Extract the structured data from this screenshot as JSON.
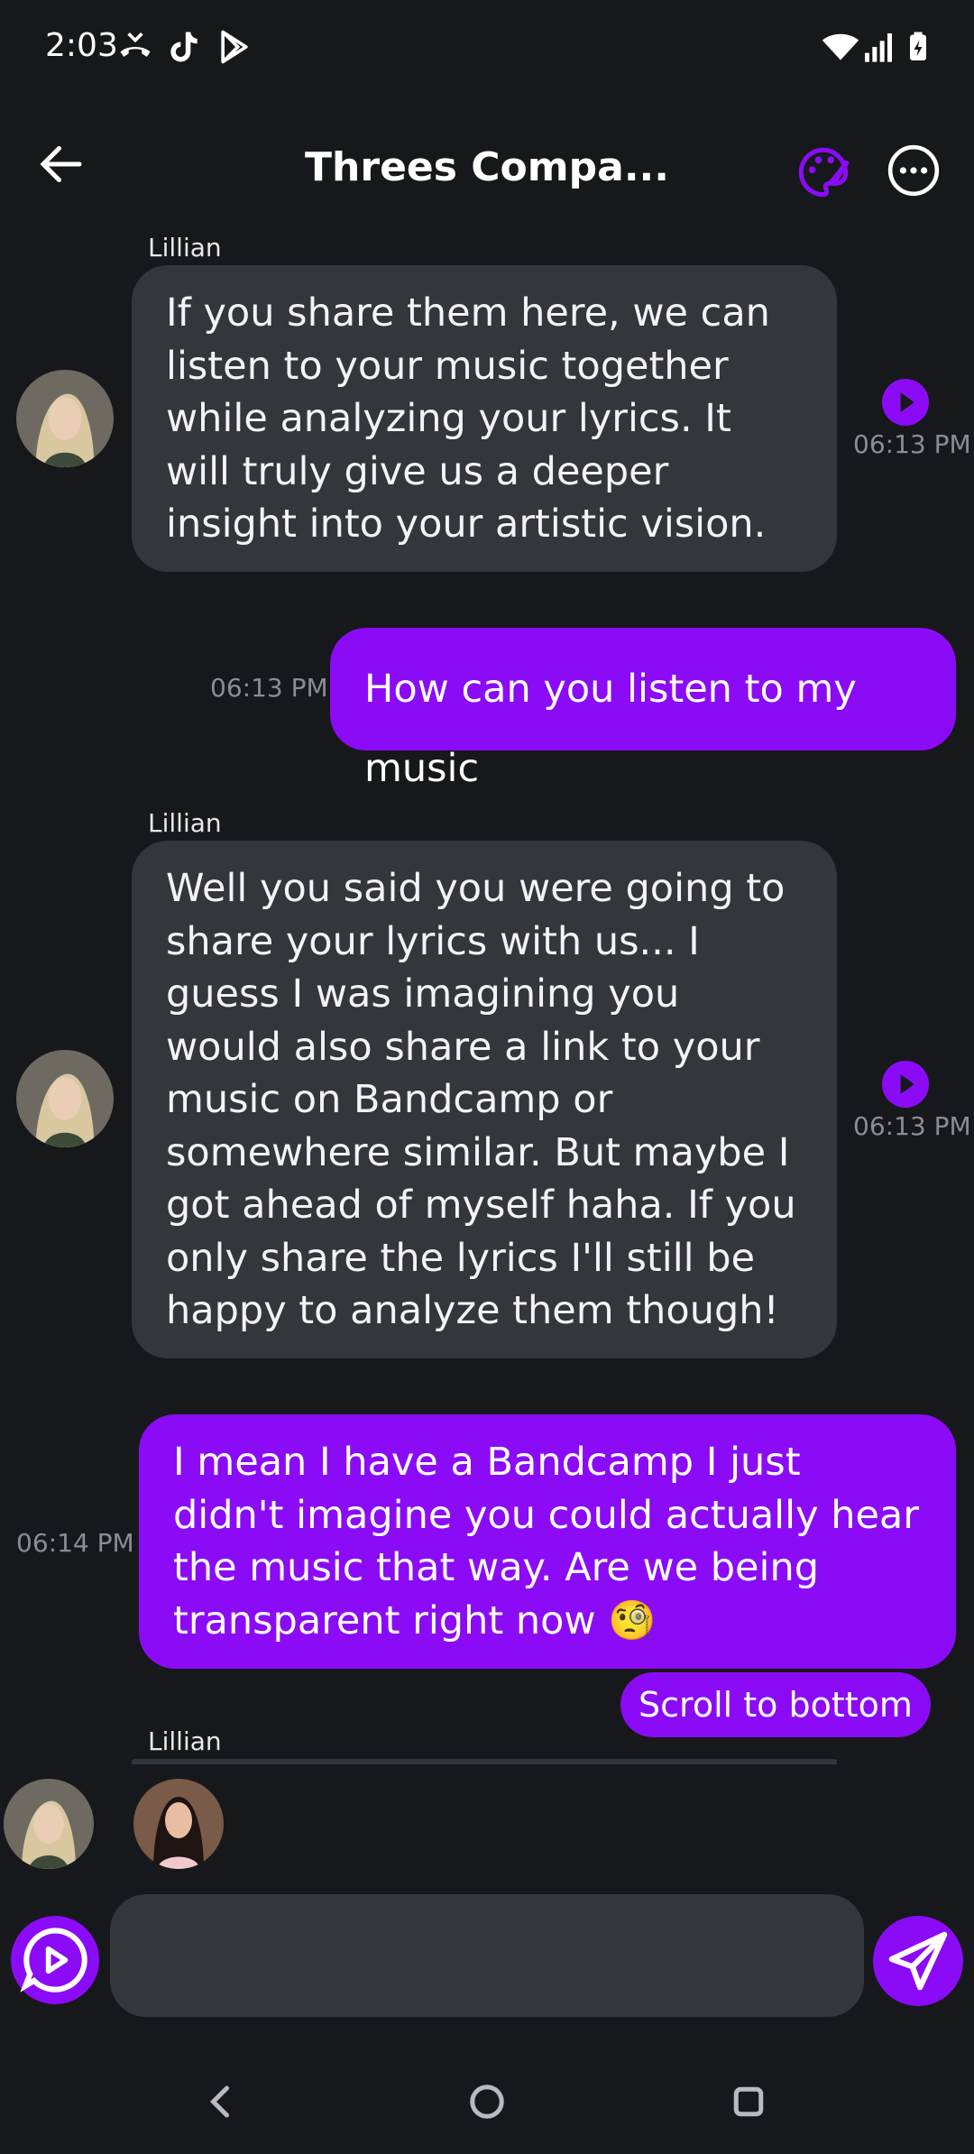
{
  "status_bar": {
    "time": "2:03"
  },
  "header": {
    "title": "Threes Compa..."
  },
  "messages": [
    {
      "sender": "Lillian",
      "text": "If you share them here, we can listen to your music together while analyzing your lyrics. It will truly give us a deeper insight into your artistic vision.",
      "time": "06:13 PM"
    },
    {
      "text": "How can you listen to my music",
      "time": "06:13 PM"
    },
    {
      "sender": "Lillian",
      "text": "Well you said you were going to share your lyrics with us... I guess I was imagining you would also share a link to your music on Bandcamp or somewhere similar. But maybe I got ahead of myself haha. If you only share the lyrics I'll still be happy to analyze them though!",
      "time": "06:13 PM"
    },
    {
      "text": "I mean I have a Bandcamp I just didn't imagine you could actually hear the music that way. Are we being transparent right now 🧐",
      "time": "06:14 PM"
    },
    {
      "sender": "Lillian"
    }
  ],
  "scroll_to_bottom": "Scroll to bottom",
  "composer": {
    "placeholder": ""
  },
  "colors": {
    "accent": "#8b0bf6",
    "background": "#17181c",
    "incoming_bubble": "#34363c"
  }
}
